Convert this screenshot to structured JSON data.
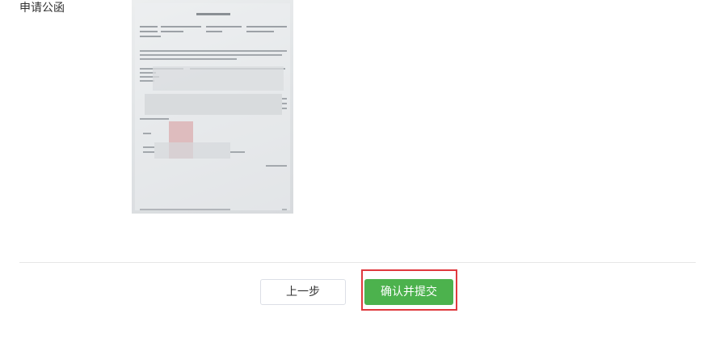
{
  "form": {
    "field_label": "申请公函"
  },
  "actions": {
    "prev_label": "上一步",
    "submit_label": "确认并提交"
  },
  "colors": {
    "submit_bg": "#4cb24d",
    "highlight_border": "#e0393e",
    "divider": "#e6e6e6"
  },
  "icons": {
    "document_thumbnail": "scanned-letter-image"
  }
}
